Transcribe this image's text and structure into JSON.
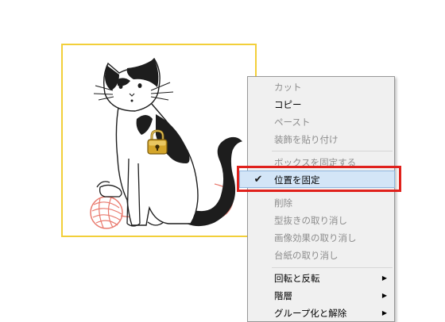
{
  "context_menu": {
    "items": [
      {
        "label": "カット",
        "enabled": false
      },
      {
        "label": "コピー",
        "enabled": true
      },
      {
        "label": "ペースト",
        "enabled": false
      },
      {
        "label": "装飾を貼り付け",
        "enabled": false
      },
      {
        "label": "ボックスを固定する",
        "enabled": false
      },
      {
        "label": "位置を固定",
        "enabled": true,
        "checked": true
      },
      {
        "label": "削除",
        "enabled": false
      },
      {
        "label": "型抜きの取り消し",
        "enabled": false
      },
      {
        "label": "画像効果の取り消し",
        "enabled": false
      },
      {
        "label": "台紙の取り消し",
        "enabled": false
      },
      {
        "label": "回転と反転",
        "enabled": true,
        "submenu": true
      },
      {
        "label": "階層",
        "enabled": true,
        "submenu": true
      },
      {
        "label": "グループ化と解除",
        "enabled": true,
        "submenu": true
      }
    ],
    "check_glyph": "✔",
    "submenu_glyph": "▶"
  },
  "image_frame": {
    "border_color": "#f2cf3a",
    "subject": "cat-illustration",
    "overlay_icon": "lock-icon"
  },
  "highlight": {
    "color": "#e0211c"
  }
}
